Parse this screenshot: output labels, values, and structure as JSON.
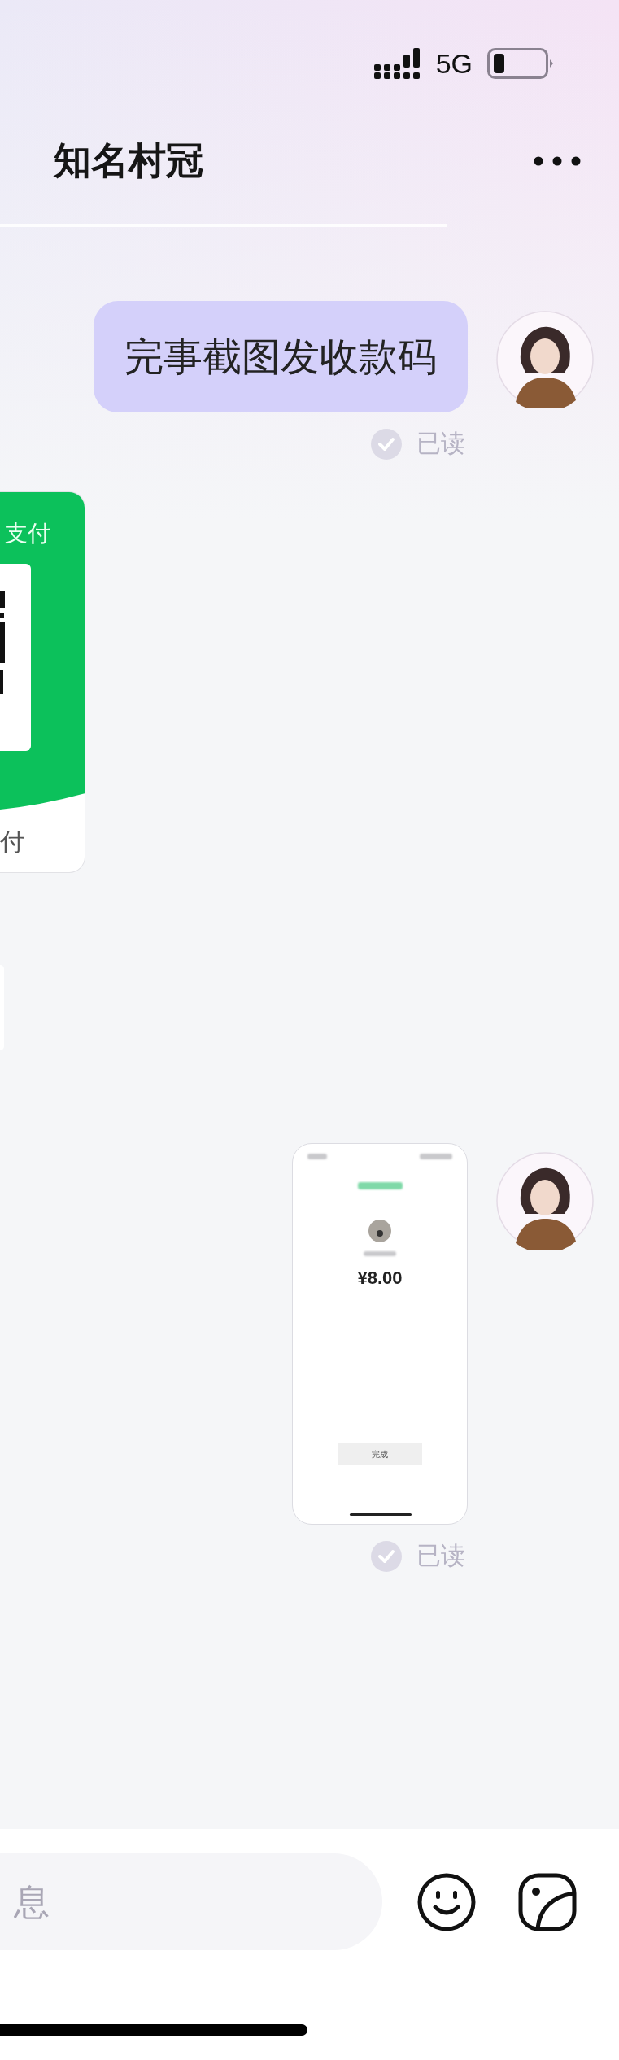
{
  "status_bar": {
    "network": "5G"
  },
  "header": {
    "title": "知名村冠"
  },
  "messages": [
    {
      "kind": "text",
      "outgoing": true,
      "text": "完事截图发收款码",
      "read": true,
      "read_label": "已读"
    },
    {
      "kind": "payment_card",
      "outgoing": false,
      "title": "支付",
      "footer": "付"
    },
    {
      "kind": "partial",
      "outgoing": false
    },
    {
      "kind": "screenshot",
      "outgoing": true,
      "amount": "¥8.00",
      "button": "完成",
      "read": true,
      "read_label": "已读"
    }
  ],
  "input": {
    "placeholder": "息"
  }
}
